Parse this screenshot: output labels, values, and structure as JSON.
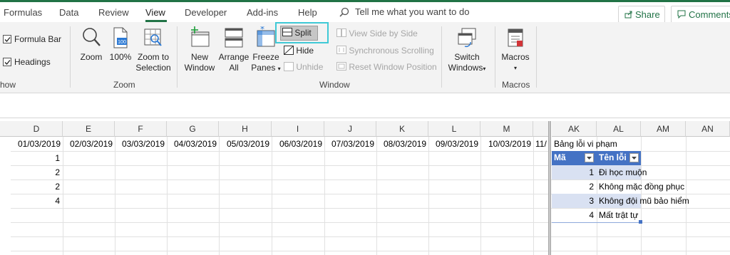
{
  "tabs": [
    "Formulas",
    "Data",
    "Review",
    "View",
    "Developer",
    "Add-ins",
    "Help"
  ],
  "tell_me": "Tell me what you want to do",
  "share_label": "Share",
  "comments_label": "Comments",
  "ribbon": {
    "show": {
      "formula_bar": "Formula Bar",
      "headings": "Headings",
      "group_label": "how"
    },
    "zoom": {
      "zoom": "Zoom",
      "hundred": "100%",
      "zoom_to": "Zoom to",
      "selection": "Selection",
      "group_label": "Zoom"
    },
    "window": {
      "new_window_1": "New",
      "new_window_2": "Window",
      "arrange_1": "Arrange",
      "arrange_2": "All",
      "freeze_1": "Freeze",
      "freeze_2": "Panes",
      "split": "Split",
      "hide": "Hide",
      "unhide": "Unhide",
      "view_side": "View Side by Side",
      "sync_scroll": "Synchronous Scrolling",
      "reset_pos": "Reset Window Position",
      "switch_1": "Switch",
      "switch_2": "Windows",
      "group_label": "Window"
    },
    "macros": {
      "label": "Macros",
      "group_label": "Macros"
    }
  },
  "left_columns": [
    "D",
    "E",
    "F",
    "G",
    "H",
    "I",
    "J",
    "K",
    "L",
    "M"
  ],
  "right_columns": [
    "AK",
    "AL",
    "AM",
    "AN"
  ],
  "dates": [
    "01/03/2019",
    "02/03/2019",
    "03/03/2019",
    "04/03/2019",
    "05/03/2019",
    "06/03/2019",
    "07/03/2019",
    "08/03/2019",
    "09/03/2019",
    "10/03/2019",
    "11/"
  ],
  "d_values": [
    "1",
    "2",
    "2",
    "4"
  ],
  "table": {
    "title": "Bảng lỗi vi phạm",
    "headers": [
      "Mã",
      "Tên lỗi"
    ],
    "codes": [
      "1",
      "2",
      "3",
      "4"
    ],
    "names": [
      "Đi học muộn",
      "Không mặc đồng phục",
      "Không đội mũ bảo hiểm",
      "Mất trật tự"
    ]
  },
  "colors": {
    "accent": "#217346",
    "table_header": "#4472c4",
    "band": "#d9e1f2",
    "highlight": "#3fc9d6"
  }
}
